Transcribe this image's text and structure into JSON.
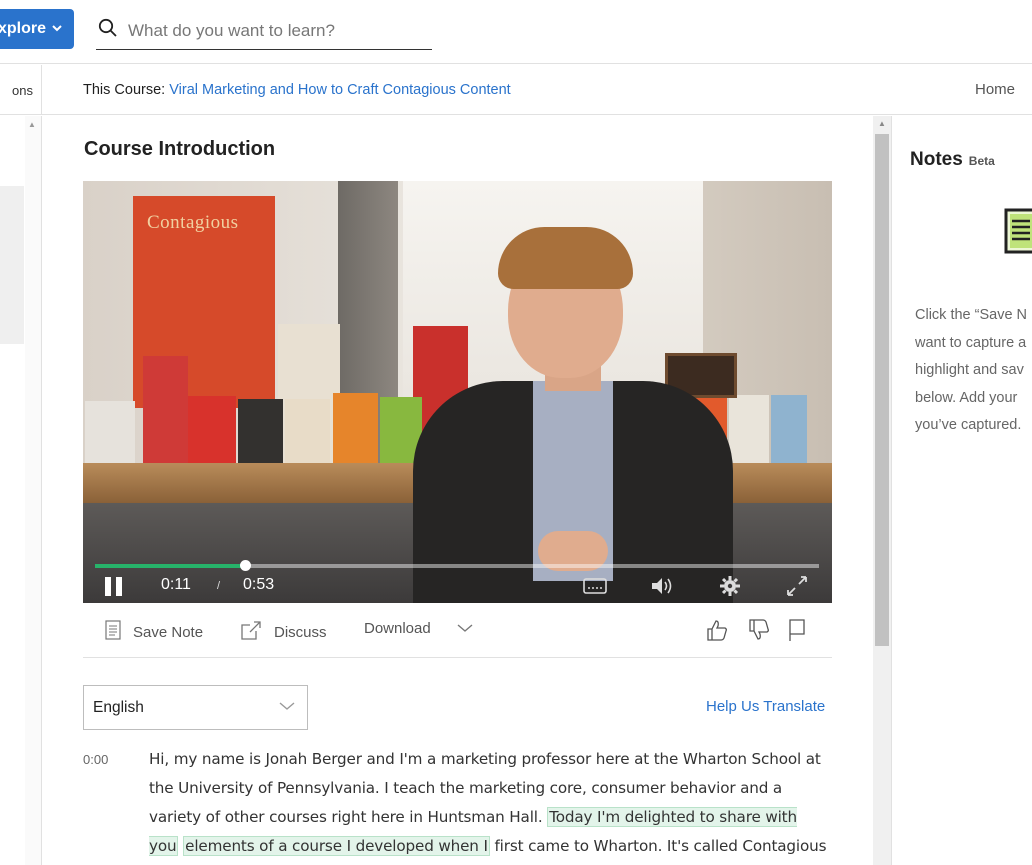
{
  "header": {
    "explore_label": "xplore",
    "search_placeholder": "What do you want to learn?"
  },
  "coursebar": {
    "left_tab": "ons",
    "prefix": "This Course:",
    "course_name": "Viral Marketing and How to Craft Contagious Content",
    "home": "Home"
  },
  "main": {
    "title": "Course Introduction",
    "video": {
      "poster_text": "Contagious",
      "current_time": "0:11",
      "separator": "/",
      "duration": "0:53",
      "progress_fraction": 0.2075,
      "progress_color": "#27b36a"
    },
    "toolbar": {
      "save_note": "Save Note",
      "discuss": "Discuss",
      "download": "Download"
    },
    "language": {
      "selected": "English",
      "help_translate": "Help Us Translate"
    },
    "transcript": {
      "timestamp": "0:00",
      "text_before": "Hi, my name is Jonah Berger and I'm a marketing professor here at the Wharton School at the University of Pennsylvania. I teach the marketing core, consumer behavior and a variety of other courses right here in Huntsman Hall. ",
      "highlight_1": "Today I'm delighted to share with you",
      "highlight_2": "elements of a course I developed when I",
      "text_after": " first came to Wharton. It's called Contagious how"
    }
  },
  "notes": {
    "title": "Notes",
    "beta": "Beta",
    "lines": [
      "Click the “Save N",
      "want to capture a",
      "highlight and sav",
      "below. Add your",
      "you’ve captured."
    ]
  },
  "colors": {
    "accent": "#2a73cc",
    "highlight_bg": "#e3f4ea"
  }
}
